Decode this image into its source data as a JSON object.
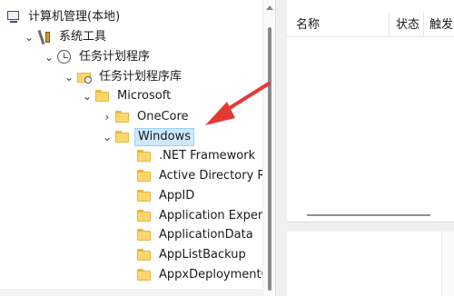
{
  "tree": {
    "nodes": [
      {
        "label": "计算机管理(本地)",
        "chevron": "",
        "icon": "computer-icon"
      },
      {
        "label": "系统工具",
        "chevron": "⌄",
        "icon": "tools-icon"
      },
      {
        "label": "任务计划程序",
        "chevron": "⌄",
        "icon": "clock-icon"
      },
      {
        "label": "任务计划程序库",
        "chevron": "⌄",
        "icon": "task-library-icon"
      },
      {
        "label": "Microsoft",
        "chevron": "⌄",
        "icon": "folder-icon"
      },
      {
        "label": "OneCore",
        "chevron": "›",
        "icon": "folder-icon"
      },
      {
        "label": "Windows",
        "chevron": "⌄",
        "icon": "folder-icon",
        "selected": true
      },
      {
        "label": ".NET Framework",
        "chevron": "",
        "icon": "folder-icon"
      },
      {
        "label": "Active Directory Ri",
        "chevron": "",
        "icon": "folder-icon"
      },
      {
        "label": "AppID",
        "chevron": "",
        "icon": "folder-icon"
      },
      {
        "label": "Application Experi",
        "chevron": "",
        "icon": "folder-icon"
      },
      {
        "label": "ApplicationData",
        "chevron": "",
        "icon": "folder-icon"
      },
      {
        "label": "AppListBackup",
        "chevron": "",
        "icon": "folder-icon"
      },
      {
        "label": "AppxDeploymentC",
        "chevron": "",
        "icon": "folder-icon"
      }
    ]
  },
  "columns": {
    "name": "名称",
    "status": "状态",
    "trigger": "触发"
  },
  "colors": {
    "selection": "#cde8ff",
    "annotation_arrow": "#e53935",
    "folder": "#ffd66b"
  }
}
